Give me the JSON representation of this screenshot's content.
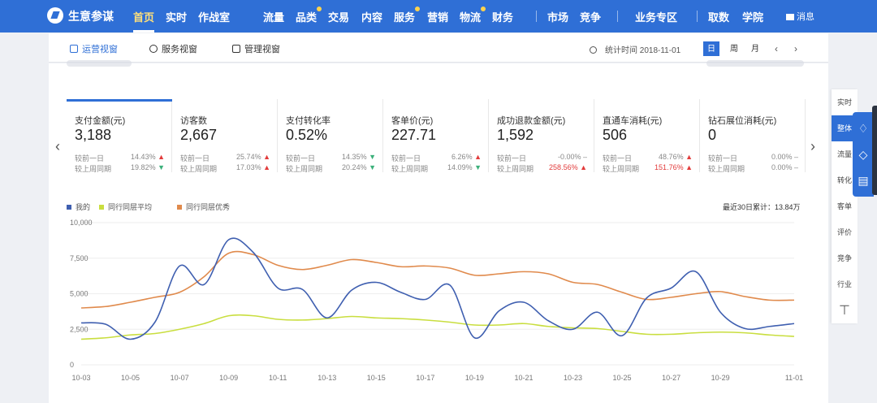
{
  "topnav": {
    "brand": "生意参谋",
    "items": [
      {
        "label": "首页",
        "active": true
      },
      {
        "label": "实时"
      },
      {
        "label": "作战室"
      },
      {
        "label": "流量"
      },
      {
        "label": "品类",
        "dot": true
      },
      {
        "label": "交易"
      },
      {
        "label": "内容"
      },
      {
        "label": "服务",
        "dot": true
      },
      {
        "label": "营销"
      },
      {
        "label": "物流",
        "dot": true
      },
      {
        "label": "财务"
      },
      {
        "label": "市场"
      },
      {
        "label": "竞争"
      },
      {
        "label": "业务专区"
      },
      {
        "label": "取数"
      },
      {
        "label": "学院"
      }
    ],
    "message": "消息"
  },
  "subbar": {
    "tabs": [
      "运营视窗",
      "服务视窗",
      "管理视窗"
    ],
    "stat_time": "统计时间 2018-11-01",
    "periods": [
      "日",
      "周",
      "月"
    ],
    "prev": "‹",
    "next": "›"
  },
  "kpis": [
    {
      "label": "支付金额(元)",
      "value": "3,188",
      "r1": "较前一日",
      "p1": "14.43%",
      "d1": "up",
      "r2": "较上周同期",
      "p2": "19.82%",
      "d2": "down"
    },
    {
      "label": "访客数",
      "value": "2,667",
      "r1": "较前一日",
      "p1": "25.74%",
      "d1": "up",
      "r2": "较上周同期",
      "p2": "17.03%",
      "d2": "up"
    },
    {
      "label": "支付转化率",
      "value": "0.52%",
      "r1": "较前一日",
      "p1": "14.35%",
      "d1": "down",
      "r2": "较上周同期",
      "p2": "20.24%",
      "d2": "down"
    },
    {
      "label": "客单价(元)",
      "value": "227.71",
      "r1": "较前一日",
      "p1": "6.26%",
      "d1": "up",
      "r2": "较上周同期",
      "p2": "14.09%",
      "d2": "down"
    },
    {
      "label": "成功退款金额(元)",
      "value": "1,592",
      "r1": "较前一日",
      "p1": "-0.00%",
      "d1": "flat",
      "r2": "较上周同期",
      "p2": "258.56%",
      "d2": "up"
    },
    {
      "label": "直通车消耗(元)",
      "value": "506",
      "r1": "较前一日",
      "p1": "48.76%",
      "d1": "up",
      "r2": "较上周同期",
      "p2": "151.76%",
      "d2": "up"
    },
    {
      "label": "钻石展位消耗(元)",
      "value": "0",
      "r1": "较前一日",
      "p1": "0.00%",
      "d1": "flat",
      "r2": "较上周同期",
      "p2": "0.00%",
      "d2": "flat"
    }
  ],
  "legend": {
    "items": [
      {
        "label": "我的",
        "color": "#3f5fb0"
      },
      {
        "label": "同行同层平均",
        "color": "#c9de3f"
      },
      {
        "label": "同行同层优秀",
        "color": "#e08a4c"
      }
    ],
    "summary": "最近30日累计：13.84万"
  },
  "chart_data": {
    "type": "line",
    "x": [
      "10-03",
      "10-04",
      "10-05",
      "10-06",
      "10-07",
      "10-08",
      "10-09",
      "10-10",
      "10-11",
      "10-12",
      "10-13",
      "10-14",
      "10-15",
      "10-16",
      "10-17",
      "10-18",
      "10-19",
      "10-20",
      "10-21",
      "10-22",
      "10-23",
      "10-24",
      "10-25",
      "10-26",
      "10-27",
      "10-28",
      "10-29",
      "10-30",
      "10-31",
      "11-01"
    ],
    "x_tick_labels": [
      "10-03",
      "10-05",
      "10-07",
      "10-09",
      "10-11",
      "10-13",
      "10-15",
      "10-17",
      "10-19",
      "10-21",
      "10-23",
      "10-25",
      "10-27",
      "10-29",
      "11-01"
    ],
    "y_tick_labels": [
      "0",
      "2,500",
      "5,000",
      "7,500",
      "10,000"
    ],
    "ylim": [
      0,
      10000
    ],
    "series": [
      {
        "name": "我的",
        "color": "#3f5fb0",
        "values": [
          2950,
          2850,
          1800,
          3000,
          6950,
          5650,
          8800,
          7900,
          5400,
          5300,
          3300,
          5250,
          5800,
          5100,
          4600,
          5600,
          1900,
          3800,
          4400,
          3100,
          2500,
          3700,
          2050,
          4700,
          5400,
          6550,
          3700,
          2550,
          2700,
          2900
        ]
      },
      {
        "name": "同行同层平均",
        "color": "#c9de3f",
        "values": [
          1800,
          1900,
          2100,
          2200,
          2500,
          2900,
          3450,
          3450,
          3200,
          3150,
          3250,
          3400,
          3300,
          3250,
          3150,
          3000,
          2800,
          2800,
          2900,
          2700,
          2600,
          2550,
          2350,
          2150,
          2150,
          2250,
          2300,
          2250,
          2100,
          2000
        ]
      },
      {
        "name": "同行同层优秀",
        "color": "#e08a4c",
        "values": [
          4000,
          4100,
          4400,
          4750,
          5100,
          6200,
          7850,
          7750,
          7000,
          6700,
          7000,
          7400,
          7200,
          6900,
          6950,
          6800,
          6300,
          6400,
          6550,
          6400,
          5800,
          5650,
          5100,
          4600,
          4750,
          5000,
          5150,
          4800,
          4550,
          4550
        ]
      }
    ]
  },
  "rightmenu": {
    "items": [
      "实时",
      "整体",
      "流量",
      "转化",
      "客单",
      "评价",
      "竞争",
      "行业"
    ],
    "active": 1,
    "top": "⊤"
  },
  "float": {
    "icons": [
      "bell-icon",
      "comment-icon",
      "chat-icon"
    ]
  }
}
